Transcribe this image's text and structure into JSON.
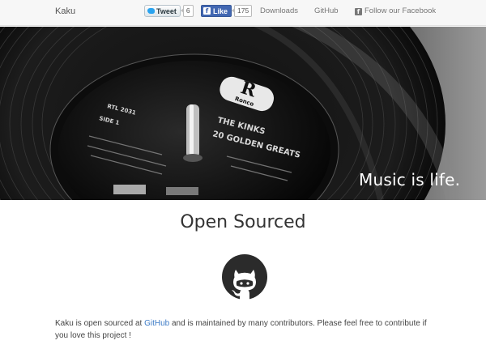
{
  "navbar": {
    "brand": "Kaku",
    "tweet": {
      "label": "Tweet",
      "count": "6"
    },
    "like": {
      "label": "Like",
      "count": "175"
    },
    "links": {
      "downloads": "Downloads",
      "github": "GitHub",
      "facebook": "Follow our Facebook"
    }
  },
  "hero": {
    "tagline": "Music is life.",
    "record_label": {
      "logo": "Ronco",
      "artist": "THE KINKS",
      "album": "20 GOLDEN GREATS",
      "side": "SIDE 1",
      "catalog": "RTL 2031"
    }
  },
  "open_source": {
    "title": "Open Sourced",
    "text_before": "Kaku is open sourced at ",
    "link_text": "GitHub",
    "text_after": " and is maintained by many contributors. Please feel free to contribute if you love this project !"
  },
  "icons": {
    "github": "github-octocat-icon",
    "twitter": "twitter-bird-icon",
    "facebook": "facebook-icon"
  }
}
